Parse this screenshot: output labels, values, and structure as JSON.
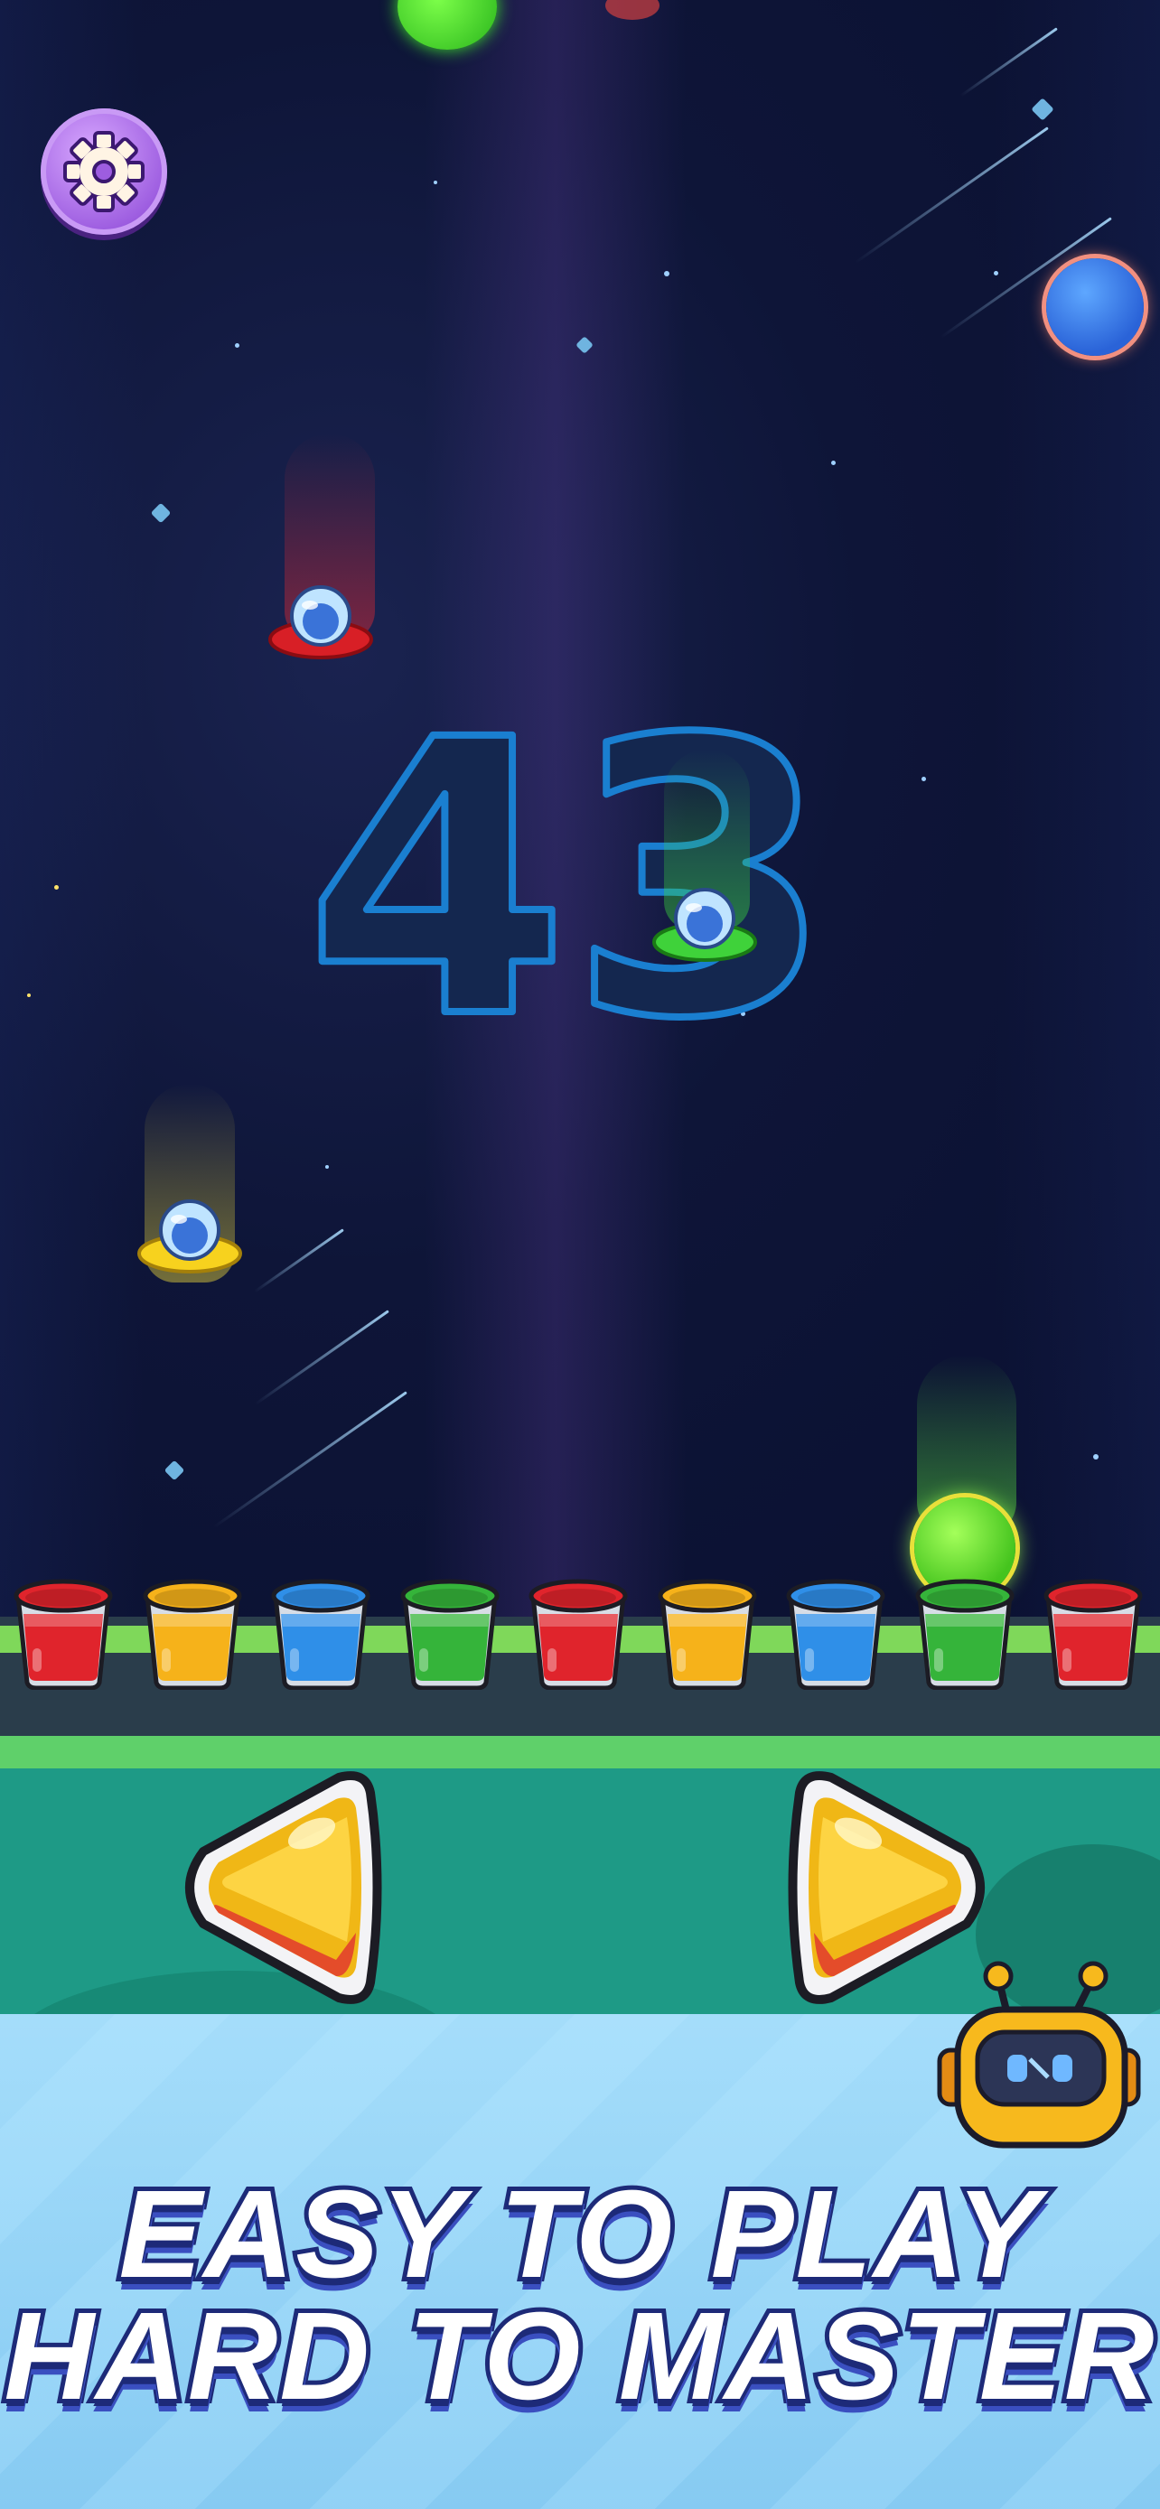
{
  "game": {
    "score": "43",
    "tagline_line1": "EASY TO PLAY",
    "tagline_line2": "HARD TO MASTER"
  },
  "icons": {
    "settings": "gear-icon",
    "left_control": "left-arrow-button",
    "right_control": "right-arrow-button"
  },
  "buckets": [
    {
      "color": "red",
      "hex": "#e0242c"
    },
    {
      "color": "yellow",
      "hex": "#f6b21a"
    },
    {
      "color": "blue",
      "hex": "#2f8fe8"
    },
    {
      "color": "green",
      "hex": "#35b43a"
    },
    {
      "color": "red",
      "hex": "#e0242c"
    },
    {
      "color": "yellow",
      "hex": "#f6b21a"
    },
    {
      "color": "blue",
      "hex": "#2f8fe8"
    },
    {
      "color": "green",
      "hex": "#35b43a"
    },
    {
      "color": "red",
      "hex": "#e0242c"
    }
  ],
  "falling_objects": [
    {
      "type": "ufo",
      "color": "red"
    },
    {
      "type": "ufo",
      "color": "green"
    },
    {
      "type": "ufo",
      "color": "yellow"
    },
    {
      "type": "planet",
      "color": "green"
    },
    {
      "type": "planet",
      "color": "blue"
    }
  ],
  "colors": {
    "background": "#0b1230",
    "score_outline": "#1a7fd0",
    "control_yellow": "#f7c21b",
    "settings_purple": "#a865ea",
    "tagline_stroke": "#1d2a78"
  }
}
